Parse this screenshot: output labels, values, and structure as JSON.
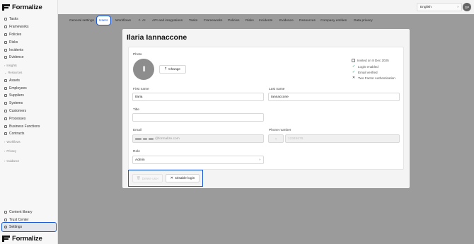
{
  "app": {
    "name": "Formalize"
  },
  "sidebar": {
    "items_top": [
      {
        "label": "Tasks",
        "icon": "tasks-icon"
      },
      {
        "label": "Frameworks",
        "icon": "frameworks-icon"
      },
      {
        "label": "Policies",
        "icon": "policies-icon"
      },
      {
        "label": "Risks",
        "icon": "risks-icon"
      },
      {
        "label": "Incidents",
        "icon": "incidents-icon"
      },
      {
        "label": "Evidence",
        "icon": "evidence-icon"
      }
    ],
    "section_insights": "Insights",
    "section_resources": "Resources",
    "items_resources": [
      {
        "label": "Assets",
        "icon": "assets-icon"
      },
      {
        "label": "Employees",
        "icon": "employees-icon"
      },
      {
        "label": "Suppliers",
        "icon": "suppliers-icon"
      },
      {
        "label": "Systems",
        "icon": "systems-icon"
      },
      {
        "label": "Customers",
        "icon": "customers-icon"
      },
      {
        "label": "Processes",
        "icon": "processes-icon"
      },
      {
        "label": "Business Functions",
        "icon": "business-functions-icon"
      },
      {
        "label": "Contracts",
        "icon": "contracts-icon"
      }
    ],
    "section_workflows": "Workflows",
    "section_privacy": "Privacy",
    "section_guidance": "Guidance",
    "content_library": "Content library",
    "trust_center": "Trust Center",
    "settings": "Settings"
  },
  "topbar": {
    "language": "English",
    "avatar_initials": "GP"
  },
  "tabs": [
    "General settings",
    "Users",
    "Workflows",
    "AI",
    "API and integrations",
    "Tasks",
    "Frameworks",
    "Policies",
    "Risks",
    "Incidents",
    "Evidence",
    "Resources",
    "Company entities",
    "Data privacy"
  ],
  "active_tab": "Users",
  "modal": {
    "title": "Ilaria Iannaccone",
    "photo_label": "Photo",
    "photo_initials": "II",
    "change_label": "Change",
    "status": {
      "invited": "Invited on 8 Dec 2025",
      "login_enabled": "Login enabled",
      "email_verified": "Email verified",
      "two_factor": "Two Factor Authentication"
    },
    "first_name_label": "First name",
    "first_name": "Ilaria",
    "last_name_label": "Last name",
    "last_name": "Iannaccone",
    "title_label": "Title",
    "title_value": "",
    "email_label": "Email",
    "email_domain": "@formalize.com",
    "phone_label": "Phone number",
    "phone_placeholder": "12345678",
    "role_label": "Role",
    "role_value": "Admin",
    "delete_label": "Delete user",
    "disable_label": "Disable login"
  },
  "colors": {
    "accent": "#1a5ad7",
    "success": "#2e9c5b"
  }
}
